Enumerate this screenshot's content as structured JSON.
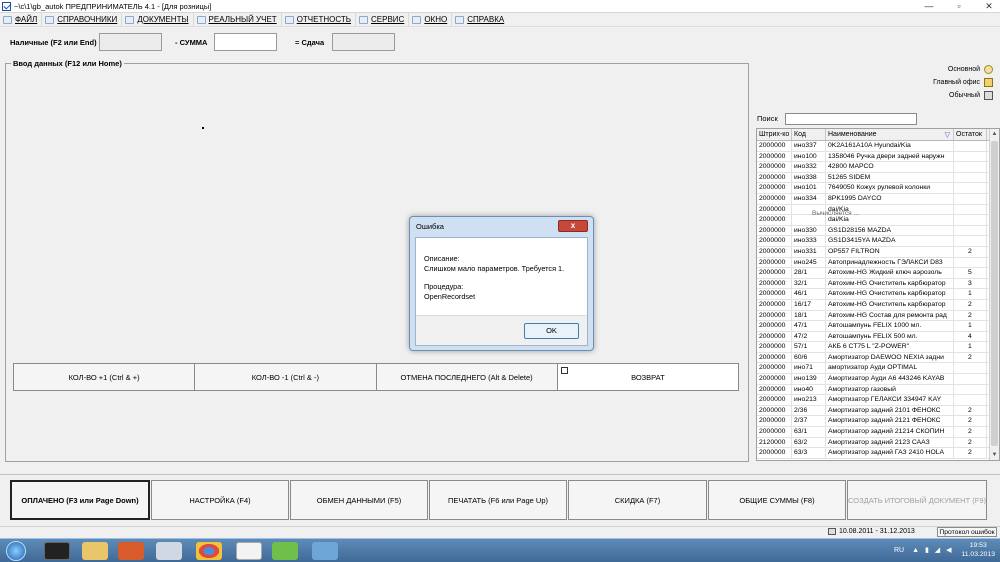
{
  "window": {
    "title": "~\\c\\1\\gb_autok ПРЕДПРИНИМАТЕЛЬ 4.1 - [Для розницы]",
    "controls": [
      "—",
      "▫",
      "✕"
    ]
  },
  "menu": [
    {
      "label": "ФАЙЛ",
      "icon": "file-icon"
    },
    {
      "label": "СПРАВОЧНИКИ",
      "icon": "book-icon"
    },
    {
      "label": "ДОКУМЕНТЫ",
      "icon": "documents-icon"
    },
    {
      "label": "РЕАЛЬНЫЙ УЧЕТ",
      "icon": "ledger-icon"
    },
    {
      "label": "ОТЧЕТНОСТЬ",
      "icon": "report-icon"
    },
    {
      "label": "СЕРВИС",
      "icon": "service-icon"
    },
    {
      "label": "ОКНО",
      "icon": "window-icon"
    },
    {
      "label": "СПРАВКА",
      "icon": "help-icon"
    }
  ],
  "payment": {
    "cash_label": "Наличные (F2 или End)",
    "sum_label": "- СУММА",
    "change_label": "= Сдача"
  },
  "entry": {
    "legend": "Ввод данных (F12 или Home)",
    "buttons": [
      "КОЛ-ВО +1     (Ctrl & +)",
      "КОЛ-ВО -1     (Ctrl & -)",
      "ОТМЕНА ПОСЛЕДНЕГО     (Alt & Delete)",
      "ВОЗВРАТ"
    ]
  },
  "price_types": [
    {
      "label": "Основной",
      "icon": "star-icon"
    },
    {
      "label": "Главный офис",
      "icon": "house-icon"
    },
    {
      "label": "Обычный",
      "icon": "printer-icon"
    }
  ],
  "search": {
    "label": "Поиск",
    "value": ""
  },
  "computing_text": "Вычисляется ...",
  "products": {
    "columns": [
      "Штрих-ко",
      "Код",
      "Наименование",
      "Остаток"
    ],
    "rows": [
      [
        "2000000",
        "ино337",
        "0K2A161A10A Hyundai/Kia",
        ""
      ],
      [
        "2000000",
        "ино100",
        "1358046 Ручка двери задней наружн",
        ""
      ],
      [
        "2000000",
        "ино332",
        "42800 MAPCO",
        ""
      ],
      [
        "2000000",
        "ино338",
        "51265 SIDEM",
        ""
      ],
      [
        "2000000",
        "ино101",
        "7649050 Кожух рулевой колонки",
        ""
      ],
      [
        "2000000",
        "ино334",
        "8PK1995 DAYCO",
        ""
      ],
      [
        "2000000",
        "",
        "dai/Kia",
        ""
      ],
      [
        "2000000",
        "",
        "dai/Kia",
        ""
      ],
      [
        "2000000",
        "ино330",
        "GS1D28156 MAZDA",
        ""
      ],
      [
        "2000000",
        "ино333",
        "GS1D3415YA MAZDA",
        ""
      ],
      [
        "2000000",
        "ино331",
        "OP557 FILTRON",
        "2"
      ],
      [
        "2000000",
        "ино245",
        "Автопринадлежность ГЭЛАКСИ D83",
        ""
      ],
      [
        "2000000",
        "28/1",
        "Автохим-HG Жидкий ключ аэрозоль",
        "5"
      ],
      [
        "2000000",
        "32/1",
        "Автохим-HG Очиститель карбюратор",
        "3"
      ],
      [
        "2000000",
        "46/1",
        "Автохим-HG Очиститель карбюратор",
        "1"
      ],
      [
        "2000000",
        "16/17",
        "Автохим-HG Очиститель карбюратор",
        "2"
      ],
      [
        "2000000",
        "18/1",
        "Автохим-HG Состав для ремонта рад",
        "2"
      ],
      [
        "2000000",
        "47/1",
        "Автошампунь FELIX 1000 мл.",
        "1"
      ],
      [
        "2000000",
        "47/2",
        "Автошампунь FELIX 500 мл.",
        "4"
      ],
      [
        "2000000",
        "57/1",
        "АКБ 6 СТ75 L \"Z-POWER\"",
        "1"
      ],
      [
        "2000000",
        "60/6",
        "Амортизатор DAEWOO NEXIA задни",
        "2"
      ],
      [
        "2000000",
        "ино71",
        "амортизатор Ауди OPTIMAL",
        ""
      ],
      [
        "2000000",
        "ино139",
        "Амортизатор Ауди А6 443246 KAYAB",
        ""
      ],
      [
        "2000000",
        "ино40",
        "Амортизатор газовый",
        ""
      ],
      [
        "2000000",
        "ино213",
        "Амортизатор ГЕЛАКСИ 334947 KAY",
        ""
      ],
      [
        "2000000",
        "2/36",
        "Амортизатор задний 2101 ФЕНОКС",
        "2"
      ],
      [
        "2000000",
        "2/37",
        "Амортизатор задний 2121 ФЕНОКС",
        "2"
      ],
      [
        "2000000",
        "63/1",
        "Амортизатор задний 21214 СКОПИН",
        "2"
      ],
      [
        "2120000",
        "63/2",
        "Амортизатор задний 2123 СААЗ",
        "2"
      ],
      [
        "2000000",
        "63/3",
        "Амортизатор задний ГАЗ 2410 HOLA",
        "2"
      ]
    ]
  },
  "dialog": {
    "title": "Ошибка",
    "close": "x",
    "desc_label": "Описание:",
    "desc_text": "Слишком мало параметров. Требуется 1.",
    "proc_label": "Процедура:",
    "proc_text": "OpenRecordset",
    "ok": "OK"
  },
  "bottom_buttons": [
    "ОПЛАЧЕНО (F3 или Page Down)",
    "НАСТРОЙКА (F4)",
    "ОБМЕН ДАННЫМИ (F5)",
    "ПЕЧАТАТЬ (F6 или Page Up)",
    "СКИДКА (F7)",
    "ОБЩИЕ СУММЫ (F8)",
    "СОЗДАТЬ ИТОГОВЫЙ ДОКУМЕНТ (F9)"
  ],
  "status": {
    "period": "10.08.2011 - 31.12.2013",
    "errors_btn": "Протокол ошибок"
  },
  "taskbar": {
    "lang": "RU",
    "time": "19:53",
    "date": "11.03.2013"
  }
}
